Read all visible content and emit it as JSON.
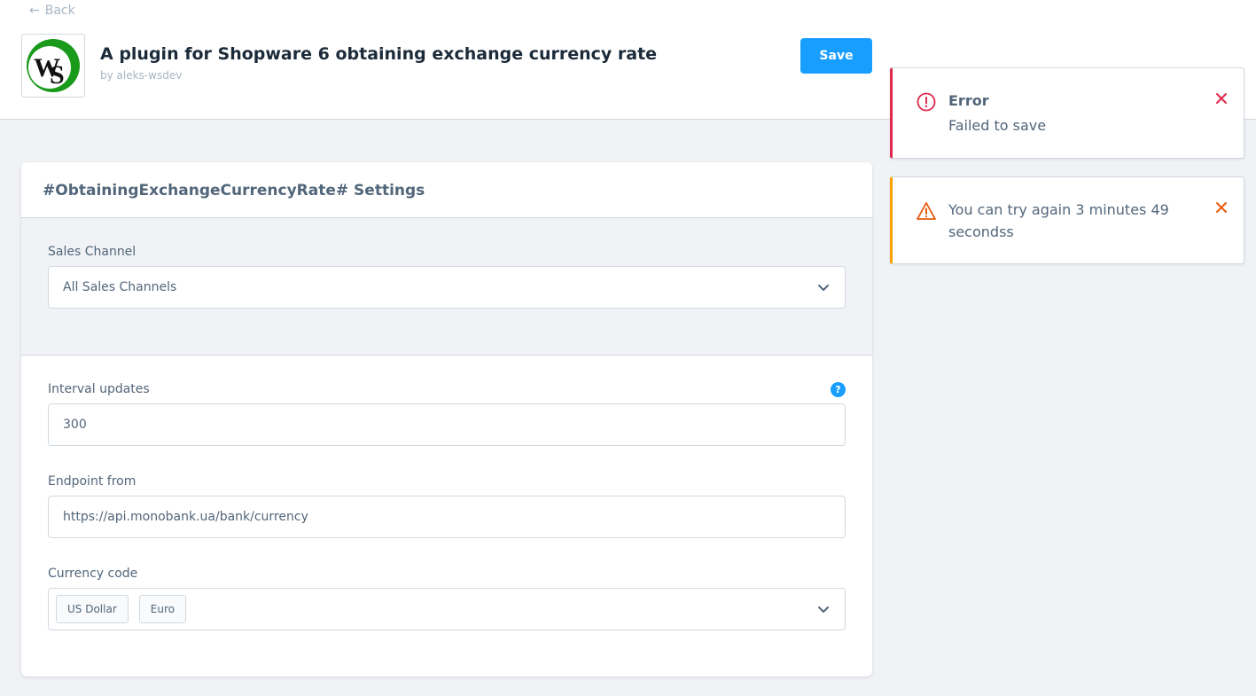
{
  "header": {
    "back_label": "Back",
    "title": "A plugin for Shopware 6 obtaining exchange currency rate",
    "author": "by aleks-wsdev",
    "save_label": "Save",
    "logo_text": "WS"
  },
  "card": {
    "title": "#ObtainingExchangeCurrencyRate# Settings",
    "sales_channel": {
      "label": "Sales Channel",
      "value": "All Sales Channels"
    },
    "interval": {
      "label": "Interval updates",
      "value": "300",
      "help_icon": "?"
    },
    "endpoint": {
      "label": "Endpoint from",
      "value": "https://api.monobank.ua/bank/currency"
    },
    "currency": {
      "label": "Currency code",
      "tags": [
        "US Dollar",
        "Euro"
      ]
    }
  },
  "notifications": [
    {
      "type": "error",
      "title": "Error",
      "message": "Failed to save",
      "color": "#de294c"
    },
    {
      "type": "warning",
      "message_line1": "You can try again 3 minutes 49",
      "message_line2": "secondss",
      "color": "#ffa000"
    }
  ],
  "colors": {
    "primary": "#189eff",
    "error": "#de294c",
    "warning": "#ffa000",
    "text": "#52667a"
  }
}
